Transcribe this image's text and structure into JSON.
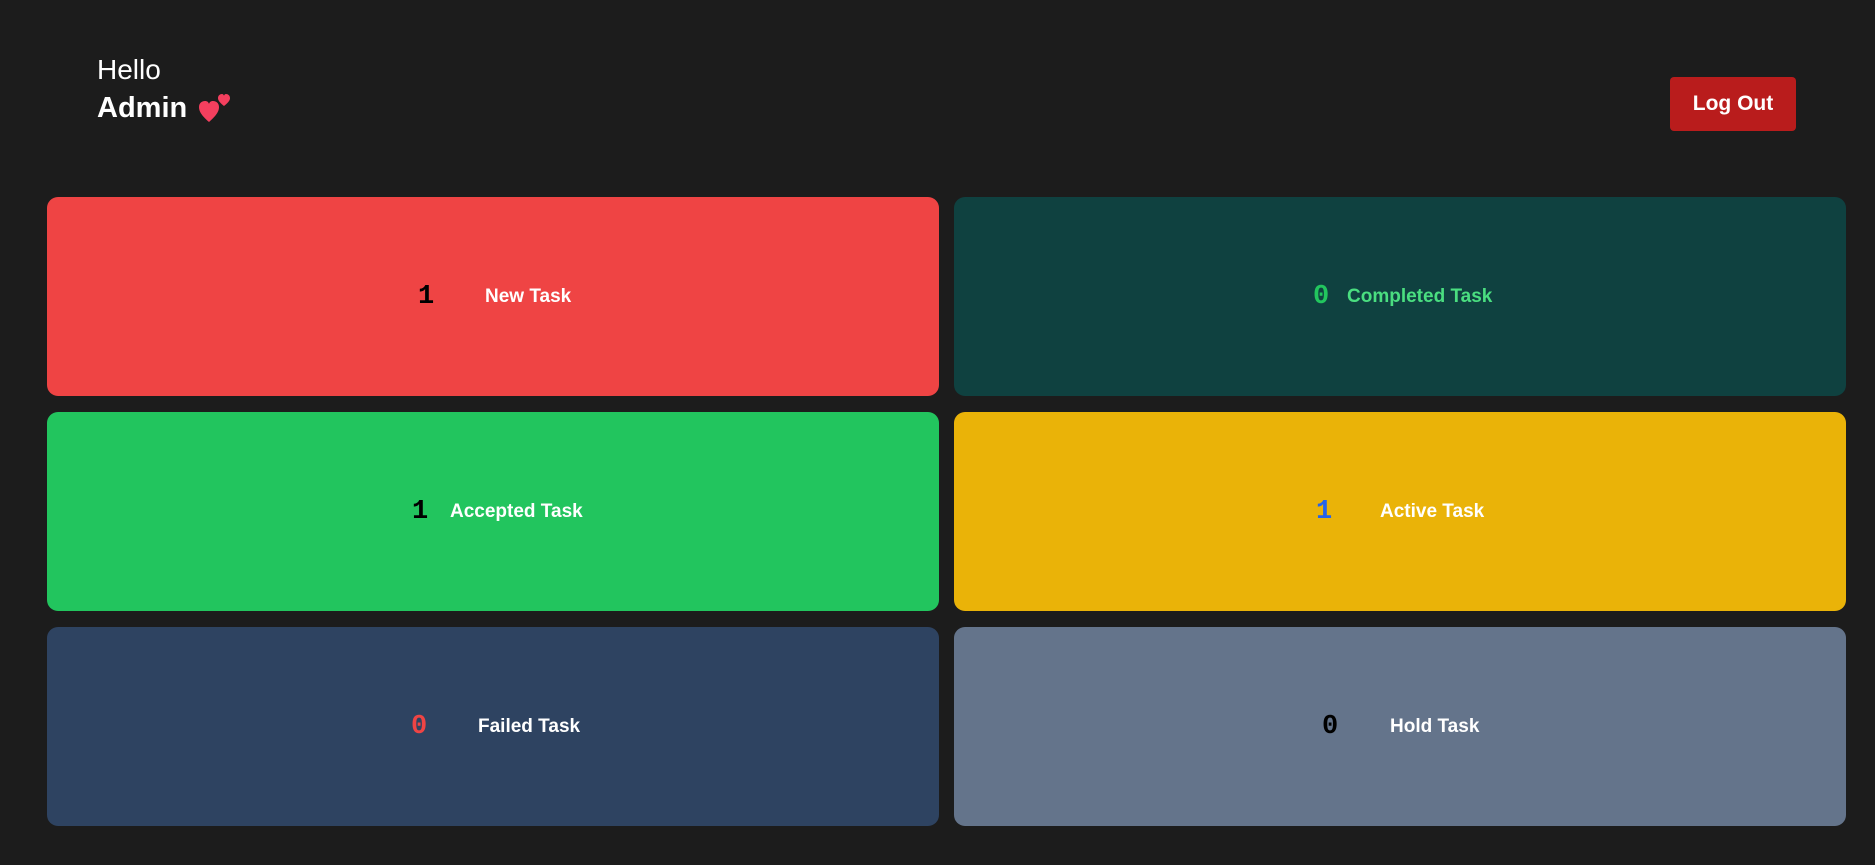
{
  "header": {
    "hello": "Hello",
    "username": "Admin",
    "heart_icon": "two-hearts-icon",
    "logout_label": "Log Out",
    "colors": {
      "background": "#1c1c1c",
      "logout_bg": "#b91c1c",
      "heart": "#f43f5e"
    }
  },
  "cards": [
    {
      "count": "1",
      "label": "New Task",
      "bg": "#ef4444",
      "count_color": "#000000",
      "label_color": "#ffffff"
    },
    {
      "count": "0",
      "label": "Completed Task",
      "bg": "#0f4140",
      "count_color": "#22c55e",
      "label_color": "#4ade80"
    },
    {
      "count": "1",
      "label": "Accepted Task",
      "bg": "#22c55e",
      "count_color": "#000000",
      "label_color": "#ffffff"
    },
    {
      "count": "1",
      "label": "Active Task",
      "bg": "#eab308",
      "count_color": "#2563eb",
      "label_color": "#ffffff"
    },
    {
      "count": "0",
      "label": "Failed Task",
      "bg": "#2e4361",
      "count_color": "#ef4444",
      "label_color": "#ffffff"
    },
    {
      "count": "0",
      "label": "Hold Task",
      "bg": "#64748b",
      "count_color": "#000000",
      "label_color": "#ffffff"
    }
  ]
}
